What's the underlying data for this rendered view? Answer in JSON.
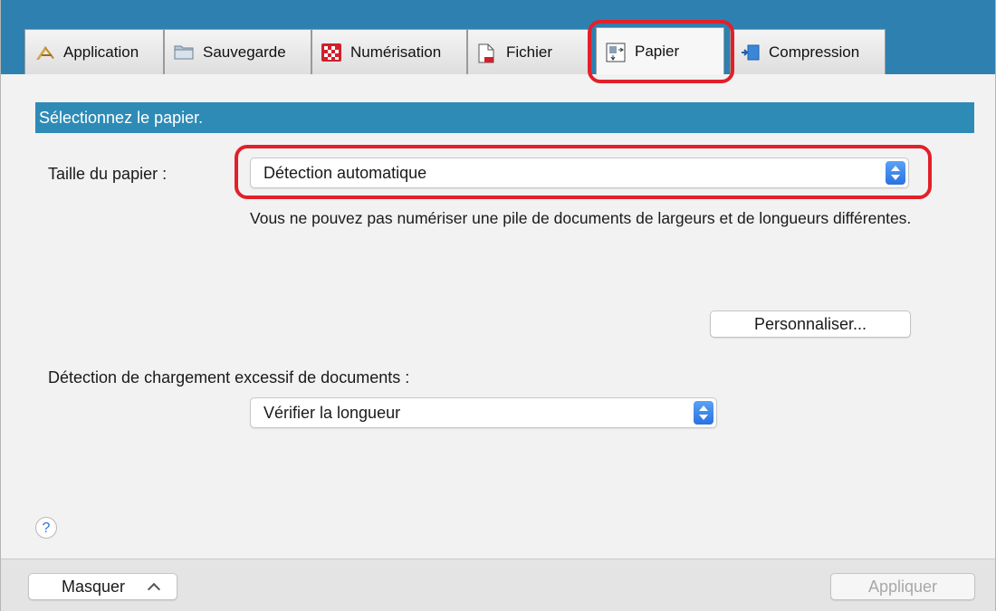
{
  "tabs": [
    {
      "label": "Application",
      "icon": "application-icon"
    },
    {
      "label": "Sauvegarde",
      "icon": "folder-icon"
    },
    {
      "label": "Numérisation",
      "icon": "scan-icon"
    },
    {
      "label": "Fichier",
      "icon": "file-icon"
    },
    {
      "label": "Papier",
      "icon": "paper-icon",
      "selected": true
    },
    {
      "label": "Compression",
      "icon": "compression-icon"
    }
  ],
  "section": {
    "title": "Sélectionnez le papier."
  },
  "paper_size": {
    "label": "Taille du papier :",
    "value": "Détection automatique",
    "note": "Vous ne pouvez pas numériser une pile de documents de largeurs et de longueurs différentes."
  },
  "customize_button": "Personnaliser...",
  "overload_detection": {
    "label": "Détection de chargement excessif de documents :",
    "value": "Vérifier la longueur"
  },
  "help": "?",
  "footer": {
    "hide_label": "Masquer",
    "apply_label": "Appliquer"
  },
  "colors": {
    "accent": "#2e8bb6",
    "highlight": "#e2202a",
    "select_arrows": "#2a72e0"
  }
}
